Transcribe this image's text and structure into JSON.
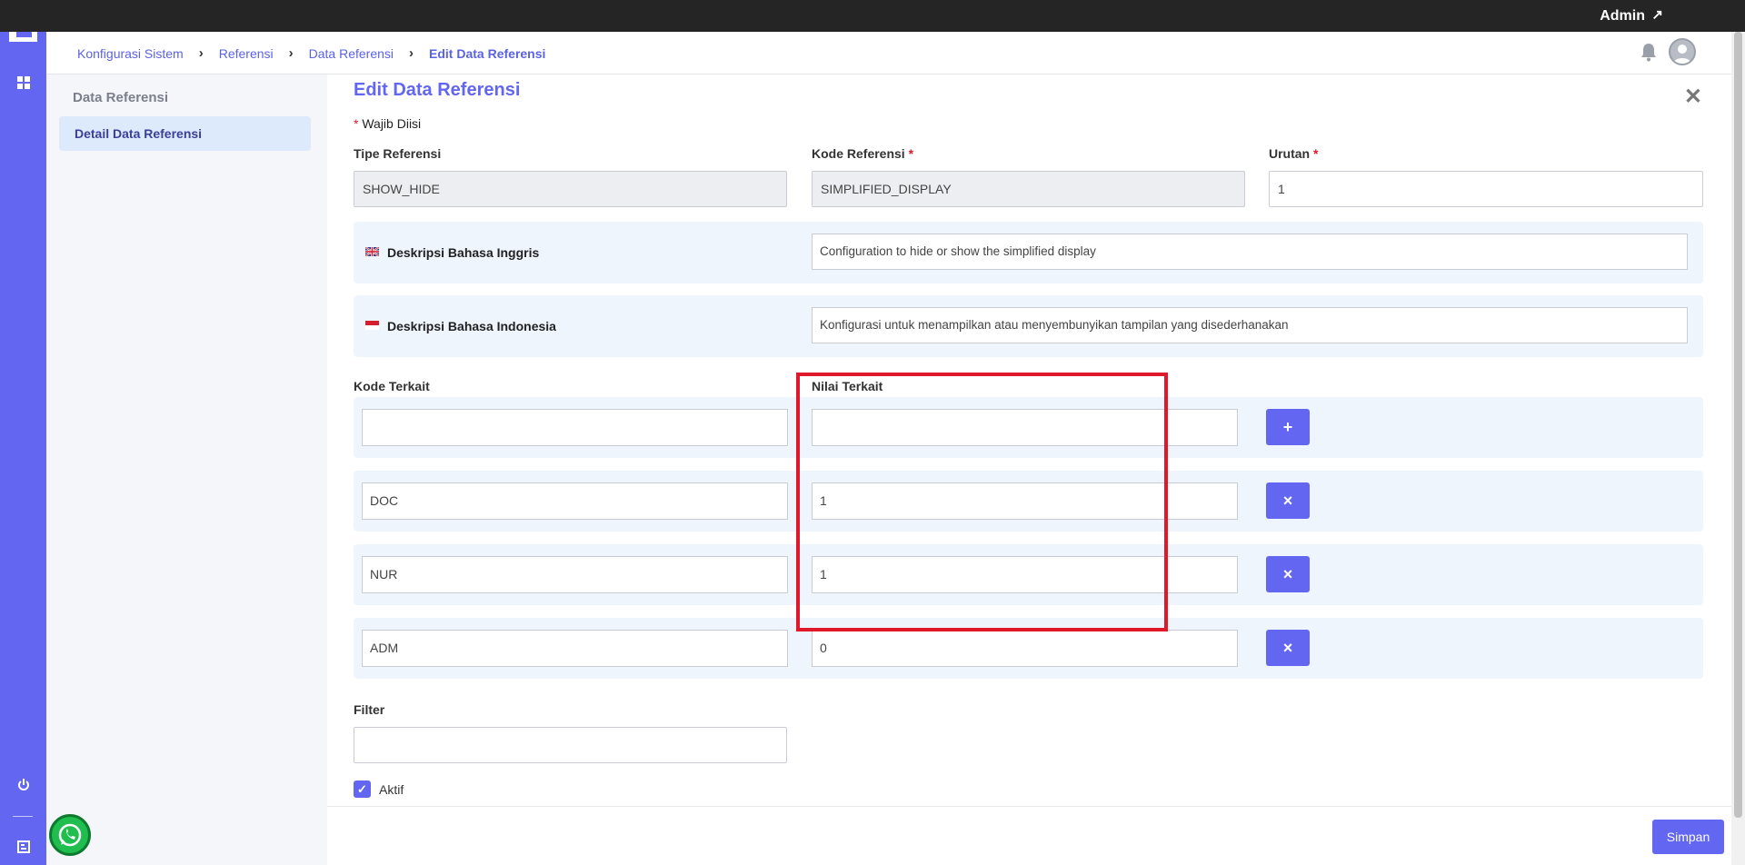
{
  "topbar": {
    "user": "Admin",
    "link_icon": "external-link-icon"
  },
  "rail": {
    "icons": [
      "app-logo",
      "grid-icon",
      "power-icon",
      "document-icon"
    ]
  },
  "breadcrumb": [
    {
      "label": "Konfigurasi Sistem"
    },
    {
      "label": "Referensi"
    },
    {
      "label": "Data Referensi"
    },
    {
      "label": "Edit Data Referensi"
    }
  ],
  "sidebar": {
    "heading": "Data Referensi",
    "active_item": "Detail Data Referensi"
  },
  "form": {
    "title": "Edit Data Referensi",
    "required_note": "Wajib Diisi",
    "required_mark": "*",
    "tipe_label": "Tipe Referensi",
    "tipe_value": "SHOW_HIDE",
    "kode_label": "Kode Referensi",
    "kode_value": "SIMPLIFIED_DISPLAY",
    "urutan_label": "Urutan",
    "urutan_value": "1",
    "desc_en_label": "Deskripsi Bahasa Inggris",
    "desc_en_value": "Configuration to hide or show the simplified display",
    "desc_id_label": "Deskripsi Bahasa Indonesia",
    "desc_id_value": "Konfigurasi untuk menampilkan atau menyembunyikan tampilan yang disederhanakan",
    "kode_terkait_label": "Kode Terkait",
    "nilai_terkait_label": "Nilai Terkait",
    "rows": [
      {
        "kode": "",
        "nilai": "",
        "action": "+"
      },
      {
        "kode": "DOC",
        "nilai": "1",
        "action": "×"
      },
      {
        "kode": "NUR",
        "nilai": "1",
        "action": "×"
      },
      {
        "kode": "ADM",
        "nilai": "0",
        "action": "×"
      }
    ],
    "filter_label": "Filter",
    "filter_value": "",
    "aktif_label": "Aktif",
    "aktif_checked": true,
    "save_label": "Simpan"
  },
  "colors": {
    "accent": "#6366f1",
    "highlight": "#e0182b",
    "band": "#eff5fd"
  }
}
